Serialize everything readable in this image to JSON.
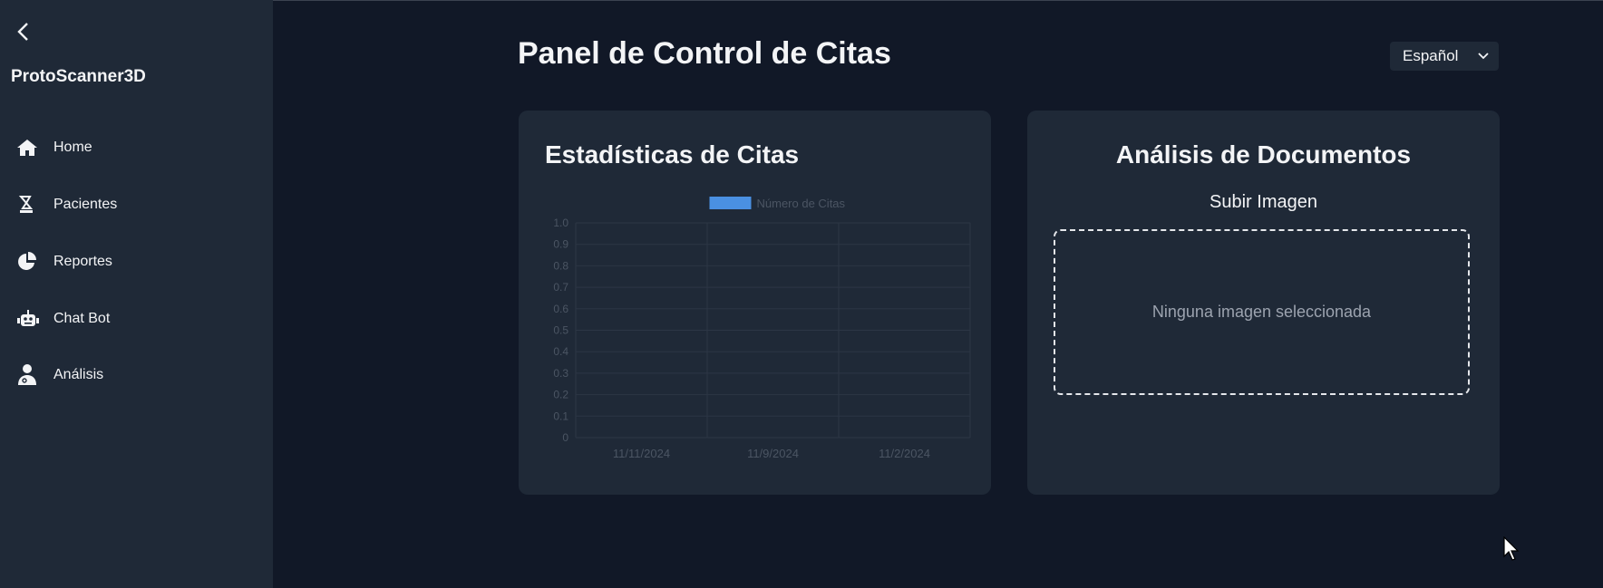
{
  "sidebar": {
    "brand": "ProtoScanner3D",
    "items": [
      {
        "label": "Home",
        "icon": "home-icon"
      },
      {
        "label": "Pacientes",
        "icon": "patients-icon"
      },
      {
        "label": "Reportes",
        "icon": "pie-chart-icon"
      },
      {
        "label": "Chat Bot",
        "icon": "robot-icon"
      },
      {
        "label": "Análisis",
        "icon": "doctor-icon"
      }
    ]
  },
  "header": {
    "title": "Panel de Control de Citas",
    "language": "Español"
  },
  "stats_card": {
    "title": "Estadísticas de Citas"
  },
  "docs_card": {
    "title": "Análisis de Documentos",
    "upload_label": "Subir Imagen",
    "dropzone_text": "Ninguna imagen seleccionada"
  },
  "colors": {
    "background": "#111827",
    "panel": "#1f2937",
    "bar": "#4a90e2"
  },
  "chart_data": {
    "type": "bar",
    "categories": [
      "11/11/2024",
      "11/9/2024",
      "11/2/2024"
    ],
    "series": [
      {
        "name": "Número de Citas",
        "values": [
          0,
          0,
          0
        ]
      }
    ],
    "ylim": [
      0,
      1.0
    ],
    "yticks": [
      "0",
      "0.1",
      "0.2",
      "0.3",
      "0.4",
      "0.5",
      "0.6",
      "0.7",
      "0.8",
      "0.9",
      "1.0"
    ],
    "legend": "top",
    "grid": true
  }
}
